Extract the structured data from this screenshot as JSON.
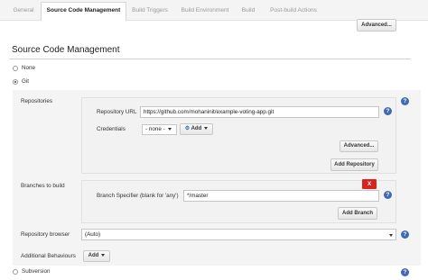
{
  "tabs": [
    {
      "label": "General"
    },
    {
      "label": "Source Code Management"
    },
    {
      "label": "Build Triggers"
    },
    {
      "label": "Build Environment"
    },
    {
      "label": "Build"
    },
    {
      "label": "Post-build Actions"
    }
  ],
  "advanced_top": "Advanced...",
  "section_title": "Source Code Management",
  "scm_options": {
    "none": "None",
    "git": "Git",
    "subversion": "Subversion"
  },
  "repositories": {
    "label": "Repositories",
    "url_label": "Repository URL",
    "url_value": "https://github.com/mohaninit/example-voting-app.git",
    "credentials_label": "Credentials",
    "credentials_value": "- none -",
    "add_label": "Add",
    "advanced_label": "Advanced...",
    "add_repository_label": "Add Repository"
  },
  "branches": {
    "label": "Branches to build",
    "specifier_label": "Branch Specifier (blank for 'any')",
    "specifier_value": "*/master",
    "delete_label": "X",
    "add_branch_label": "Add Branch"
  },
  "browser": {
    "label": "Repository browser",
    "value": "(Auto)"
  },
  "behaviours": {
    "label": "Additional Behaviours",
    "add_label": "Add"
  },
  "help_glyph": "?",
  "colors": {
    "accent": "#3e6ab5",
    "delete": "#d9231d",
    "panel": "#f2f2f2"
  }
}
